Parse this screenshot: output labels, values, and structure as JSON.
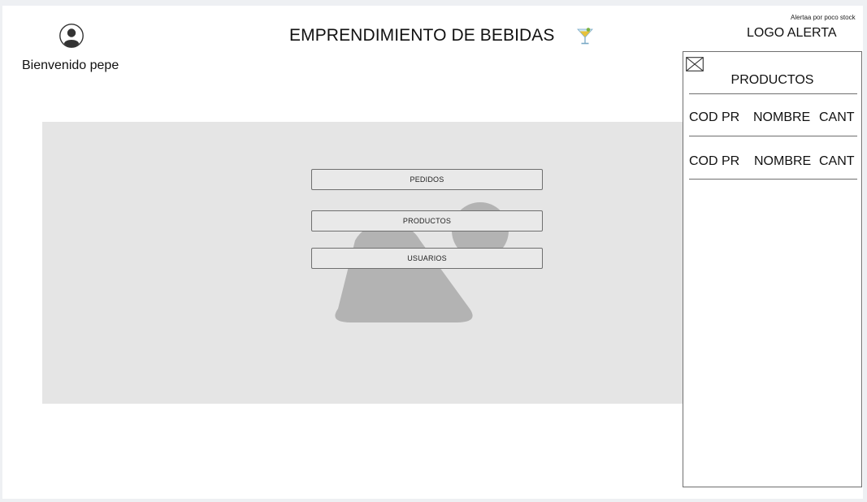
{
  "header": {
    "welcome": "Bienvenido pepe",
    "title": "EMPRENDIMIENTO DE BEBIDAS",
    "title_icon": "cocktail-glass-icon",
    "alert_note": "Alertaa por poco stock",
    "logo_alert": "LOGO ALERTA"
  },
  "menu": {
    "buttons": [
      {
        "label": "PEDIDOS"
      },
      {
        "label": "PRODUCTOS"
      },
      {
        "label": "USUARIOS"
      }
    ]
  },
  "alert_panel": {
    "close_icon": "close-box-icon",
    "title": "PRODUCTOS",
    "columns": [
      "COD PR",
      "NOMBRE",
      "CANT"
    ],
    "rows": [
      {
        "code": "COD PR",
        "name": "NOMBRE",
        "qty": "CANT"
      },
      {
        "code": "COD PR",
        "name": "NOMBRE",
        "qty": "CANT"
      }
    ]
  },
  "colors": {
    "content_bg": "#e5e5e5",
    "placeholder_shape": "#b3b3b3",
    "button_bg": "#e9e9e9",
    "border": "#6f6f6f"
  }
}
